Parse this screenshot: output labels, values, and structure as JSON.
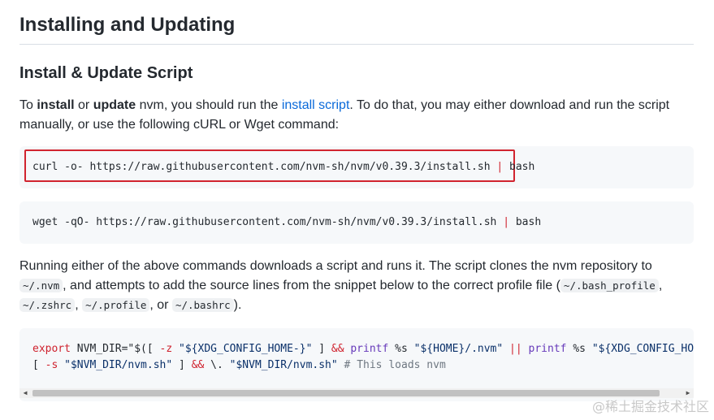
{
  "heading": "Installing and Updating",
  "subheading": "Install & Update Script",
  "intro": {
    "t1": "To ",
    "b1": "install",
    "t2": " or ",
    "b2": "update",
    "t3": " nvm, you should run the ",
    "link": "install script",
    "t4": ". To do that, you may either download and run the script manually, or use the following cURL or Wget command:"
  },
  "curl_cmd": {
    "cmd": "curl -o- https://raw.githubusercontent.com/nvm-sh/nvm/v0.39.3/install.sh ",
    "pipe": "|",
    "tail": " bash"
  },
  "wget_cmd": {
    "cmd": "wget -qO- https://raw.githubusercontent.com/nvm-sh/nvm/v0.39.3/install.sh ",
    "pipe": "|",
    "tail": " bash"
  },
  "running": {
    "t1": "Running either of the above commands downloads a script and runs it. The script clones the nvm repository to ",
    "c1": "~/.nvm",
    "t2": ", and attempts to add the source lines from the snippet below to the correct profile file (",
    "c2": "~/.bash_profile",
    "t3": ", ",
    "c3": "~/.zshrc",
    "t4": ", ",
    "c4": "~/.profile",
    "t5": ", or ",
    "c5": "~/.bashrc",
    "t6": ")."
  },
  "snippet": {
    "l1": [
      {
        "k": "kw",
        "t": "export"
      },
      {
        "k": "",
        "t": " NVM_DIR=\"$("
      },
      {
        "k": "",
        "t": "[ "
      },
      {
        "k": "kw",
        "t": "-z"
      },
      {
        "k": "str",
        "t": " \"${XDG_CONFIG_HOME-}\""
      },
      {
        "k": "",
        "t": " ] "
      },
      {
        "k": "kw",
        "t": "&&"
      },
      {
        "k": "",
        "t": " "
      },
      {
        "k": "fn",
        "t": "printf"
      },
      {
        "k": "",
        "t": " %s "
      },
      {
        "k": "str",
        "t": "\"${HOME}/.nvm\""
      },
      {
        "k": "",
        "t": " "
      },
      {
        "k": "kw",
        "t": "||"
      },
      {
        "k": "",
        "t": " "
      },
      {
        "k": "fn",
        "t": "printf"
      },
      {
        "k": "",
        "t": " %s "
      },
      {
        "k": "str",
        "t": "\"${XDG_CONFIG_HOME}/n"
      }
    ],
    "l2": [
      {
        "k": "",
        "t": "[ "
      },
      {
        "k": "kw",
        "t": "-s"
      },
      {
        "k": "str",
        "t": " \"$NVM_DIR/nvm.sh\""
      },
      {
        "k": "",
        "t": " ] "
      },
      {
        "k": "kw",
        "t": "&&"
      },
      {
        "k": "",
        "t": " \\. "
      },
      {
        "k": "str",
        "t": "\"$NVM_DIR/nvm.sh\""
      },
      {
        "k": "",
        "t": " "
      },
      {
        "k": "cm",
        "t": "# This loads nvm"
      }
    ]
  },
  "scroll_left_arrow": "◀",
  "scroll_right_arrow": "▶",
  "watermark": "@稀土掘金技术社区"
}
